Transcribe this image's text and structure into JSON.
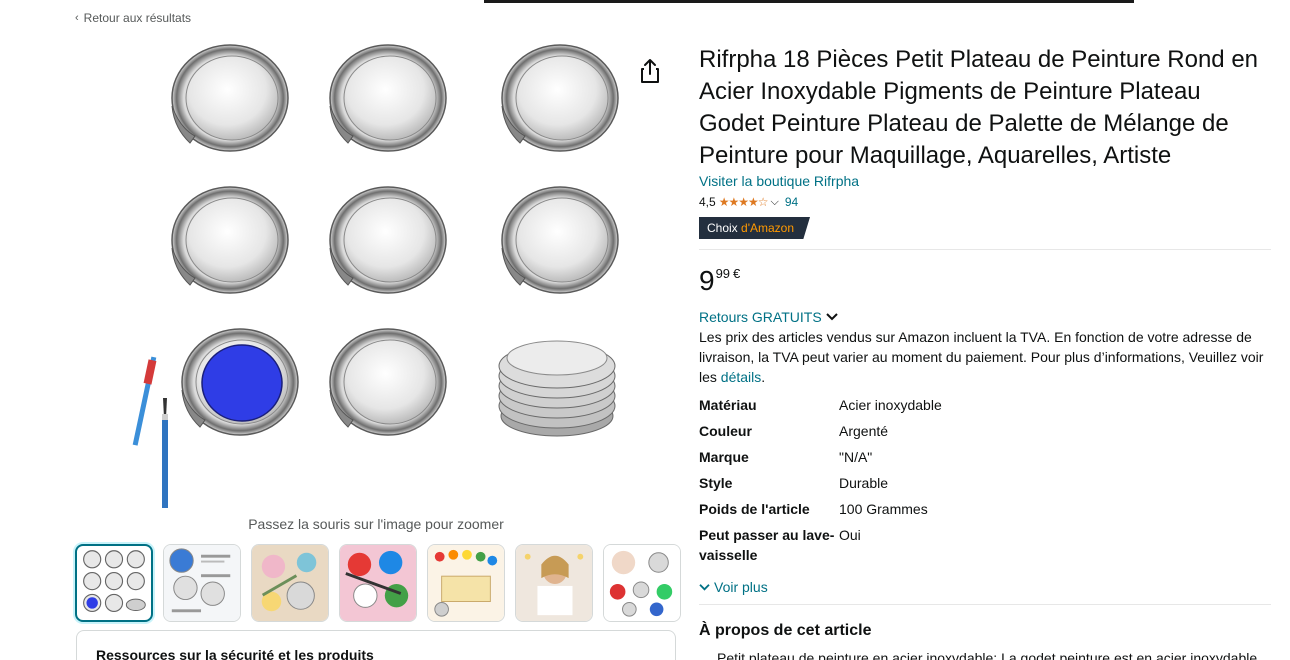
{
  "nav": {
    "back_label": "Retour aux résultats",
    "back_icon": "chevron-left-icon"
  },
  "gallery": {
    "zoom_hint": "Passez la souris sur l'image pour zoomer",
    "share_icon": "share-icon",
    "thumbnails": [
      "thumb-1",
      "thumb-2",
      "thumb-3",
      "thumb-4",
      "thumb-5",
      "thumb-6",
      "thumb-7"
    ],
    "active_thumbnail": 0
  },
  "safety": {
    "title": "Ressources sur la sécurité et les produits"
  },
  "product": {
    "title": "Rifrpha 18 Pièces Petit Plateau de Peinture Rond en Acier Inoxydable Pigments de Peinture Plateau Godet Peinture Plateau de Palette de Mélange de Peinture pour Maquillage, Aquarelles, Artiste",
    "store_link": "Visiter la boutique Rifrpha",
    "rating": "4,5",
    "rating_count": "94",
    "badge_prefix": "Choix ",
    "badge_brand": "d'Amazon",
    "price_whole": "9",
    "price_fraction": "99",
    "price_currency": "€",
    "returns_label": "Retours GRATUITS",
    "tva_text": "Les prix des articles vendus sur Amazon incluent la TVA. En fonction de votre adresse de livraison, la TVA peut varier au moment du paiement. Pour plus d’informations, Veuillez voir les ",
    "tva_link": "détails",
    "tva_end": "."
  },
  "specs": [
    {
      "key": "Matériau",
      "value": "Acier inoxydable"
    },
    {
      "key": "Couleur",
      "value": "Argenté"
    },
    {
      "key": "Marque",
      "value": "\"N/A\""
    },
    {
      "key": "Style",
      "value": "Durable"
    },
    {
      "key": "Poids de l'article",
      "value": "100 Grammes"
    },
    {
      "key": "Peut passer au lave-vaisselle",
      "value": "Oui"
    }
  ],
  "voir_plus": "Voir plus",
  "about": {
    "title": "À propos de cet article",
    "bullet_1": "Petit plateau de peinture en acier inoxydable: La godet peinture est en acier inoxydable"
  },
  "colors": {
    "link": "#007185",
    "star": "#de7921",
    "badge_bg": "#232f3e",
    "badge_accent": "#ff9900",
    "paint_blue": "#2f3de6"
  }
}
